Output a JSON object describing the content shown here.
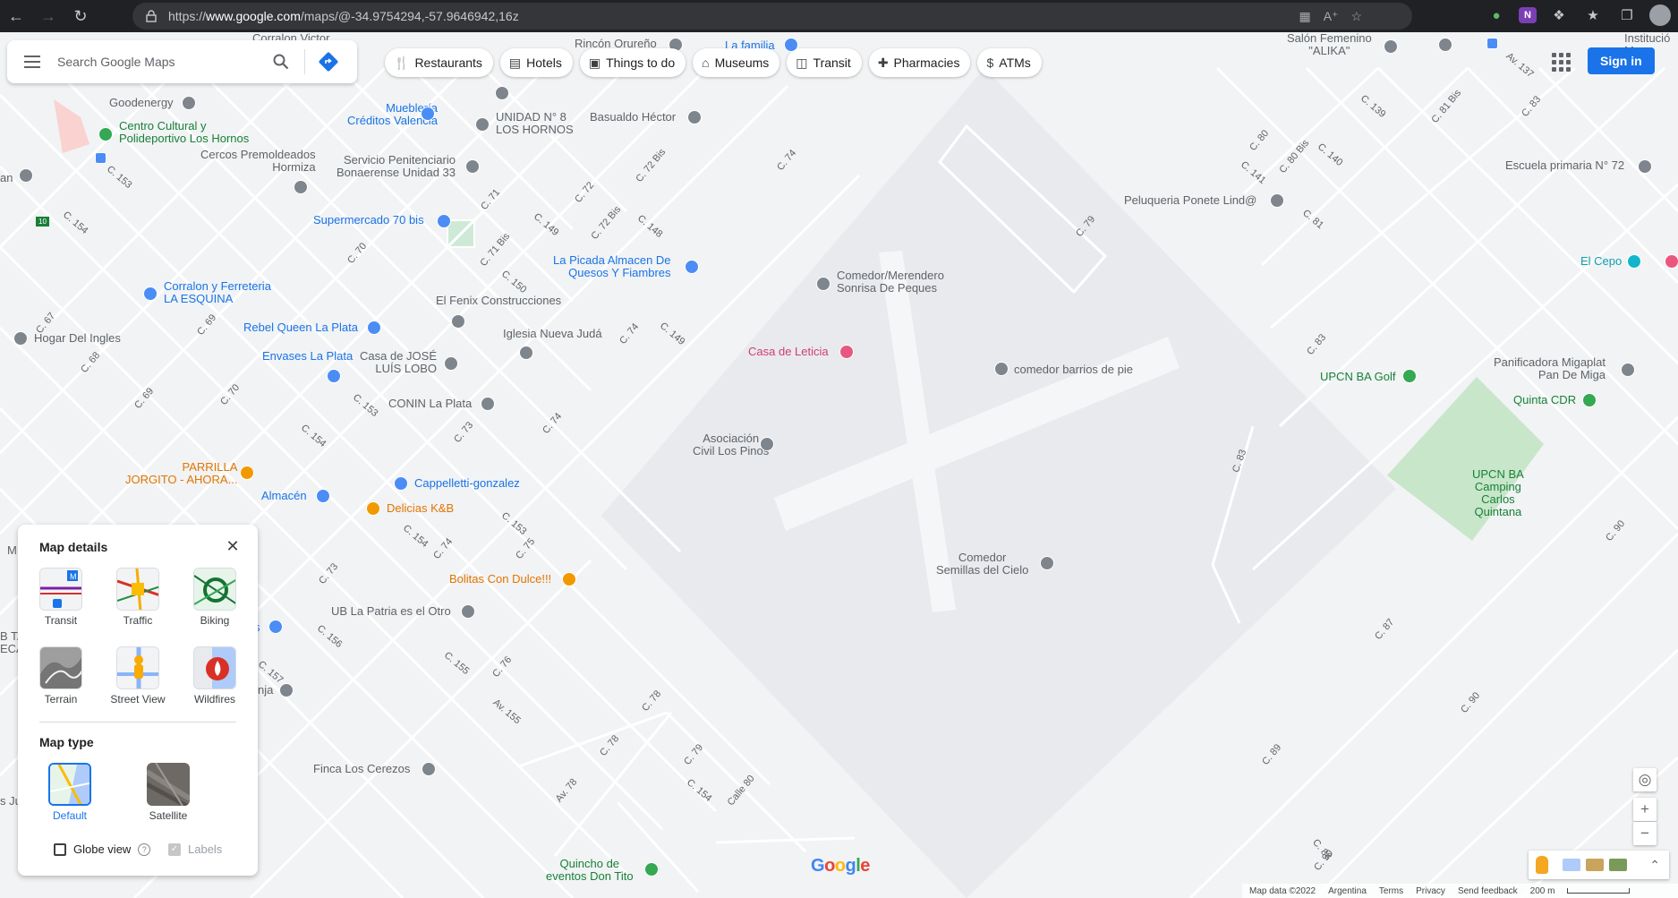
{
  "browser": {
    "url_prefix": "https://",
    "url_host": "www.google.com",
    "url_path": "/maps/@-34.9754294,-57.9646942,16z"
  },
  "search": {
    "placeholder": "Search Google Maps"
  },
  "chips": [
    {
      "label": "Restaurants",
      "icon": "fork-knife-icon"
    },
    {
      "label": "Hotels",
      "icon": "bed-icon"
    },
    {
      "label": "Things to do",
      "icon": "camera-icon"
    },
    {
      "label": "Museums",
      "icon": "museum-icon"
    },
    {
      "label": "Transit",
      "icon": "train-icon"
    },
    {
      "label": "Pharmacies",
      "icon": "pharmacy-icon"
    },
    {
      "label": "ATMs",
      "icon": "atm-icon"
    }
  ],
  "header": {
    "sign_in": "Sign in"
  },
  "places": [
    {
      "name": "Corralon Victor",
      "kind": "gray"
    },
    {
      "name": "Rincón Orureño",
      "kind": "gray"
    },
    {
      "name": "La familia",
      "kind": "blue"
    },
    {
      "name": "Salón Femenino\n\"ALIKA\"",
      "kind": "gray"
    },
    {
      "name": "Institució\nMan",
      "kind": "gray"
    },
    {
      "name": "Goodenergy",
      "kind": "gray"
    },
    {
      "name": "Centro Cultural y\nPolideportivo Los Hornos",
      "kind": "green"
    },
    {
      "name": "Mueblería\nCréditos Valencia",
      "kind": "blue"
    },
    {
      "name": "UNIDAD N° 8\nLOS HORNOS",
      "kind": "gray"
    },
    {
      "name": "Basualdo Héctor",
      "kind": "gray"
    },
    {
      "name": "Cercos Premoldeados\nHormiza",
      "kind": "gray"
    },
    {
      "name": "Servicio Penitenciario\nBonaerense Unidad 33",
      "kind": "gray"
    },
    {
      "name": "Escuela primaria N° 72",
      "kind": "gray"
    },
    {
      "name": "Peluqueria Ponete Lind@",
      "kind": "gray"
    },
    {
      "name": "Supermercado 70 bis",
      "kind": "blue"
    },
    {
      "name": "La Picada Almacen De\nQuesos Y Fiambres",
      "kind": "blue"
    },
    {
      "name": "El Cepo",
      "kind": "teal"
    },
    {
      "name": "Comedor/Merendero\nSonrisa De Peques",
      "kind": "gray"
    },
    {
      "name": "Corralon y Ferreteria\nLA ESQUINA",
      "kind": "blue"
    },
    {
      "name": "El Fenix Construcciones",
      "kind": "gray"
    },
    {
      "name": "Rebel Queen La Plata",
      "kind": "blue"
    },
    {
      "name": "Iglesia Nueva Judá",
      "kind": "gray"
    },
    {
      "name": "Hogar Del Ingles",
      "kind": "gray"
    },
    {
      "name": "Casa de Leticia",
      "kind": "pink"
    },
    {
      "name": "Envases La Plata",
      "kind": "blue"
    },
    {
      "name": "Casa de JOSÉ\nLUÍS LOBO",
      "kind": "gray"
    },
    {
      "name": "comedor barrios de pie",
      "kind": "gray"
    },
    {
      "name": "UPCN BA Golf",
      "kind": "green"
    },
    {
      "name": "Panificadora Migaplat\nPan De Miga",
      "kind": "gray"
    },
    {
      "name": "CONIN La Plata",
      "kind": "gray"
    },
    {
      "name": "Quinta CDR",
      "kind": "green"
    },
    {
      "name": "Asociación\nCivil Los Pinos",
      "kind": "gray"
    },
    {
      "name": "PARRILLA\nJORGITO - AHORA...",
      "kind": "orange"
    },
    {
      "name": "Cappelletti-gonzalez",
      "kind": "blue"
    },
    {
      "name": "UPCN BA\nCamping\nCarlos\nQuintana",
      "kind": "green"
    },
    {
      "name": "Almacén",
      "kind": "blue"
    },
    {
      "name": "Delicias K&B",
      "kind": "orange"
    },
    {
      "name": "Comedor\nSemillas del Cielo",
      "kind": "gray"
    },
    {
      "name": "Bolitas Con Dulce!!!",
      "kind": "orange"
    },
    {
      "name": "UB La Patria es el Otro",
      "kind": "gray"
    },
    {
      "name": "nja",
      "kind": "gray"
    },
    {
      "name": "Finca Los Cerezos",
      "kind": "gray"
    },
    {
      "name": "Quincho de\neventos Don Tito",
      "kind": "green"
    },
    {
      "name": "an",
      "kind": "gray"
    },
    {
      "name": "M",
      "kind": "gray"
    },
    {
      "name": "B TA\nECA",
      "kind": "gray"
    },
    {
      "name": "s Ju",
      "kind": "gray"
    },
    {
      "name": "s",
      "kind": "blue"
    }
  ],
  "roads": [
    "C. 153",
    "C. 154",
    "C. 67",
    "C. 68",
    "C. 69",
    "C. 70",
    "C. 69",
    "C. 70",
    "C. 71",
    "C. 71 Bis",
    "C. 72",
    "C. 72 Bis",
    "C. 72 Bis",
    "C. 149",
    "C. 148",
    "C. 150",
    "C. 74",
    "C. 74",
    "C. 74",
    "C. 149",
    "C. 153",
    "C. 73",
    "C. 154",
    "C. 153",
    "C. 75",
    "C. 154",
    "C. 74",
    "C. 73",
    "C. 156",
    "C. 157",
    "C. 155",
    "C. 76",
    "Av. 155",
    "C. 78",
    "C. 78",
    "C. 79",
    "C. 154",
    "Calle 80",
    "Av. 78",
    "C. 79",
    "C. 80",
    "C. 141",
    "C. 80 Bis",
    "C. 140",
    "C. 139",
    "C. 81 Bis",
    "Av. 137",
    "C. 83",
    "C. 81",
    "C. 83",
    "C. 83",
    "C. 87",
    "C. 89",
    "C. 90",
    "C. 90",
    "C. 88",
    "C. 90"
  ],
  "map_details": {
    "title": "Map details",
    "tiles": [
      {
        "label": "Transit"
      },
      {
        "label": "Traffic"
      },
      {
        "label": "Biking"
      },
      {
        "label": "Terrain"
      },
      {
        "label": "Street View"
      },
      {
        "label": "Wildfires"
      }
    ],
    "map_type_title": "Map type",
    "types": [
      {
        "label": "Default",
        "selected": true
      },
      {
        "label": "Satellite",
        "selected": false
      }
    ],
    "globe_view": "Globe view",
    "labels": "Labels"
  },
  "footer": {
    "map_data": "Map data ©2022",
    "country": "Argentina",
    "terms": "Terms",
    "privacy": "Privacy",
    "feedback": "Send feedback",
    "scale": "200 m"
  },
  "google_logo": "Google"
}
